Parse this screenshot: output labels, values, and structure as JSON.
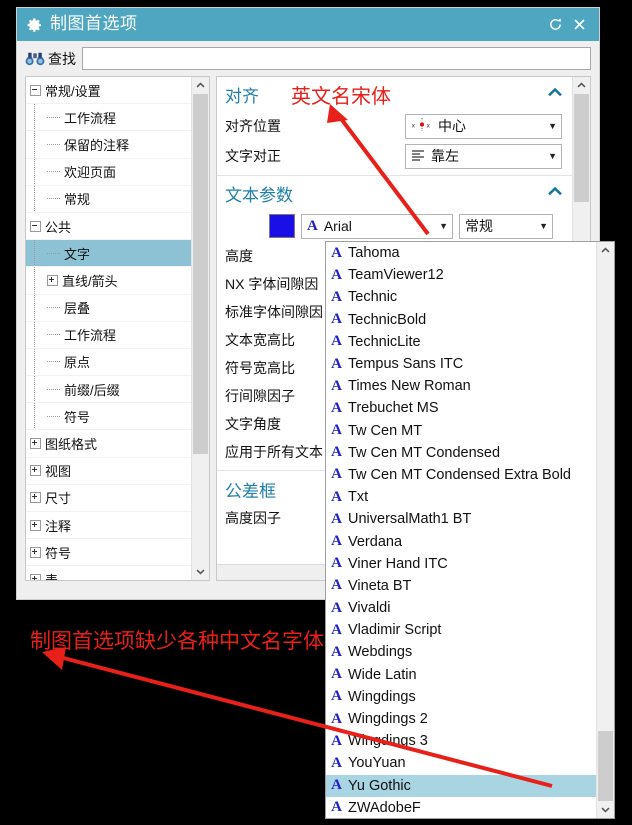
{
  "window": {
    "title": "制图首选项",
    "gear_icon": "gear-icon",
    "reset_icon": "reset-icon",
    "close_icon": "close-icon"
  },
  "find": {
    "icon": "binoculars-icon",
    "label": "查找",
    "value": "",
    "placeholder": ""
  },
  "tree": {
    "nodes": [
      {
        "label": "常规/设置",
        "depth": 0,
        "toggle": "minus"
      },
      {
        "label": "工作流程",
        "depth": 1,
        "toggle": "none"
      },
      {
        "label": "保留的注释",
        "depth": 1,
        "toggle": "none"
      },
      {
        "label": "欢迎页面",
        "depth": 1,
        "toggle": "none"
      },
      {
        "label": "常规",
        "depth": 1,
        "toggle": "none"
      },
      {
        "label": "公共",
        "depth": 0,
        "toggle": "minus"
      },
      {
        "label": "文字",
        "depth": 1,
        "toggle": "none",
        "selected": true
      },
      {
        "label": "直线/箭头",
        "depth": 1,
        "toggle": "plus"
      },
      {
        "label": "层叠",
        "depth": 1,
        "toggle": "none"
      },
      {
        "label": "工作流程",
        "depth": 1,
        "toggle": "none"
      },
      {
        "label": "原点",
        "depth": 1,
        "toggle": "none"
      },
      {
        "label": "前缀/后缀",
        "depth": 1,
        "toggle": "none"
      },
      {
        "label": "符号",
        "depth": 1,
        "toggle": "none"
      },
      {
        "label": "图纸格式",
        "depth": 0,
        "toggle": "plus"
      },
      {
        "label": "视图",
        "depth": 0,
        "toggle": "plus"
      },
      {
        "label": "尺寸",
        "depth": 0,
        "toggle": "plus"
      },
      {
        "label": "注释",
        "depth": 0,
        "toggle": "plus"
      },
      {
        "label": "符号",
        "depth": 0,
        "toggle": "plus"
      },
      {
        "label": "表",
        "depth": 0,
        "toggle": "plus"
      }
    ]
  },
  "panel": {
    "groups": [
      {
        "title": "对齐",
        "collapse_icon": "chevron-up-icon",
        "rows": [
          {
            "label": "对齐位置",
            "value": "中心",
            "icon": "align-point-icon",
            "control": "combo"
          },
          {
            "label": "文字对正",
            "value": "靠左",
            "icon": "align-left-icon",
            "control": "combo"
          }
        ]
      },
      {
        "title": "文本参数",
        "collapse_icon": "chevron-up-icon",
        "rows": [
          {
            "label": "",
            "value": "Arial",
            "style_value": "常规",
            "swatch_color": "#1b0fe8",
            "control": "font-combo"
          },
          {
            "label": "高度",
            "value": "",
            "control": "field"
          },
          {
            "label": "NX 字体间隙因",
            "value": "",
            "control": "field"
          },
          {
            "label": "标准字体间隙因",
            "value": "",
            "control": "field"
          },
          {
            "label": "文本宽高比",
            "value": "",
            "control": "field"
          },
          {
            "label": "符号宽高比",
            "value": "",
            "control": "field"
          },
          {
            "label": "行间隙因子",
            "value": "",
            "control": "field"
          },
          {
            "label": "文字角度",
            "value": "",
            "control": "field"
          },
          {
            "label": "应用于所有文本",
            "value": "",
            "control": "field"
          }
        ]
      },
      {
        "title": "公差框",
        "collapse_icon": "",
        "rows": [
          {
            "label": "高度因子",
            "value": "",
            "control": "field"
          }
        ]
      }
    ],
    "scroll_down_icon": "chevron-down-icon"
  },
  "font_dropdown": {
    "item_icon": "font-A-icon",
    "selected": "Yu Gothic",
    "items": [
      "Tahoma",
      "TeamViewer12",
      "Technic",
      "TechnicBold",
      "TechnicLite",
      "Tempus Sans ITC",
      "Times New Roman",
      "Trebuchet MS",
      "Tw Cen MT",
      "Tw Cen MT Condensed",
      "Tw Cen MT Condensed Extra Bold",
      "Txt",
      "UniversalMath1 BT",
      "Verdana",
      "Viner Hand ITC",
      "Vineta BT",
      "Vivaldi",
      "Vladimir Script",
      "Webdings",
      "Wide Latin",
      "Wingdings",
      "Wingdings 2",
      "Wingdings 3",
      "YouYuan",
      "Yu Gothic",
      "ZWAdobeF"
    ],
    "scroll_up_icon": "chevron-up-icon",
    "scroll_down_icon": "chevron-down-icon"
  },
  "annotations": {
    "top": "英文名宋体",
    "bottom": "制图首选项缺少各种中文名字体",
    "color": "#e8201a"
  },
  "colors": {
    "titlebar": "#4ea6c0",
    "selection": "#8cc2d4",
    "dropdown_selection": "#a9d5e3",
    "group_title": "#1f7fa8",
    "font_swatch": "#1b0fe8",
    "annotation_red": "#e8201a"
  }
}
